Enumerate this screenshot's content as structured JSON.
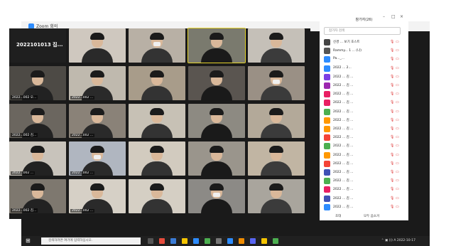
{
  "window": {
    "title": "Zoom 회의"
  },
  "meeting": {
    "title": "2022101013 집..."
  },
  "tiles": [
    {
      "name": "2022101013 집..."
    },
    {
      "name": ""
    },
    {
      "name": ""
    },
    {
      "name": ""
    },
    {
      "name": ""
    },
    {
      "name": "2022...002 오..."
    },
    {
      "name": "2022...002 ..."
    },
    {
      "name": ""
    },
    {
      "name": ""
    },
    {
      "name": ""
    },
    {
      "name": "2022...002 김..."
    },
    {
      "name": "2022...002 ..."
    },
    {
      "name": ""
    },
    {
      "name": ""
    },
    {
      "name": ""
    },
    {
      "name": "2022...002 ..."
    },
    {
      "name": "2022...002 ..."
    },
    {
      "name": ""
    },
    {
      "name": ""
    },
    {
      "name": ""
    },
    {
      "name": "2022...002 김..."
    },
    {
      "name": "2022...002 ..."
    },
    {
      "name": ""
    },
    {
      "name": ""
    },
    {
      "name": ""
    }
  ],
  "panel": {
    "title": "참가자(26)",
    "search_placeholder": "참가자 검색",
    "participants": [
      "신경 ... 보기 호스트",
      "Rammy... 1 ... (나)",
      "Pa..._...",
      "2022 ... 2...",
      "2022 ... 김 ...",
      "2022 ... 김 ...",
      "2022 ... 김 ...",
      "2022 ... 김 ...",
      "2022 ... 김 ...",
      "2022 ... 김 ...",
      "2022 ... 김 ...",
      "2022 ... 김 ...",
      "2022 ... 김 ...",
      "2022 ... 김 ...",
      "2022 ... 김 ...",
      "2022 ... 김 ...",
      "2022 ... 김 ...",
      "2022 ... 김 ...",
      "2022 ... 김 ...",
      "2022 ... 김 ..."
    ],
    "invite_label": "초대",
    "mute_all_label": "모두 음소거"
  },
  "taskbar": {
    "search_placeholder": "검색하려면 여기에 입력하십시오."
  }
}
